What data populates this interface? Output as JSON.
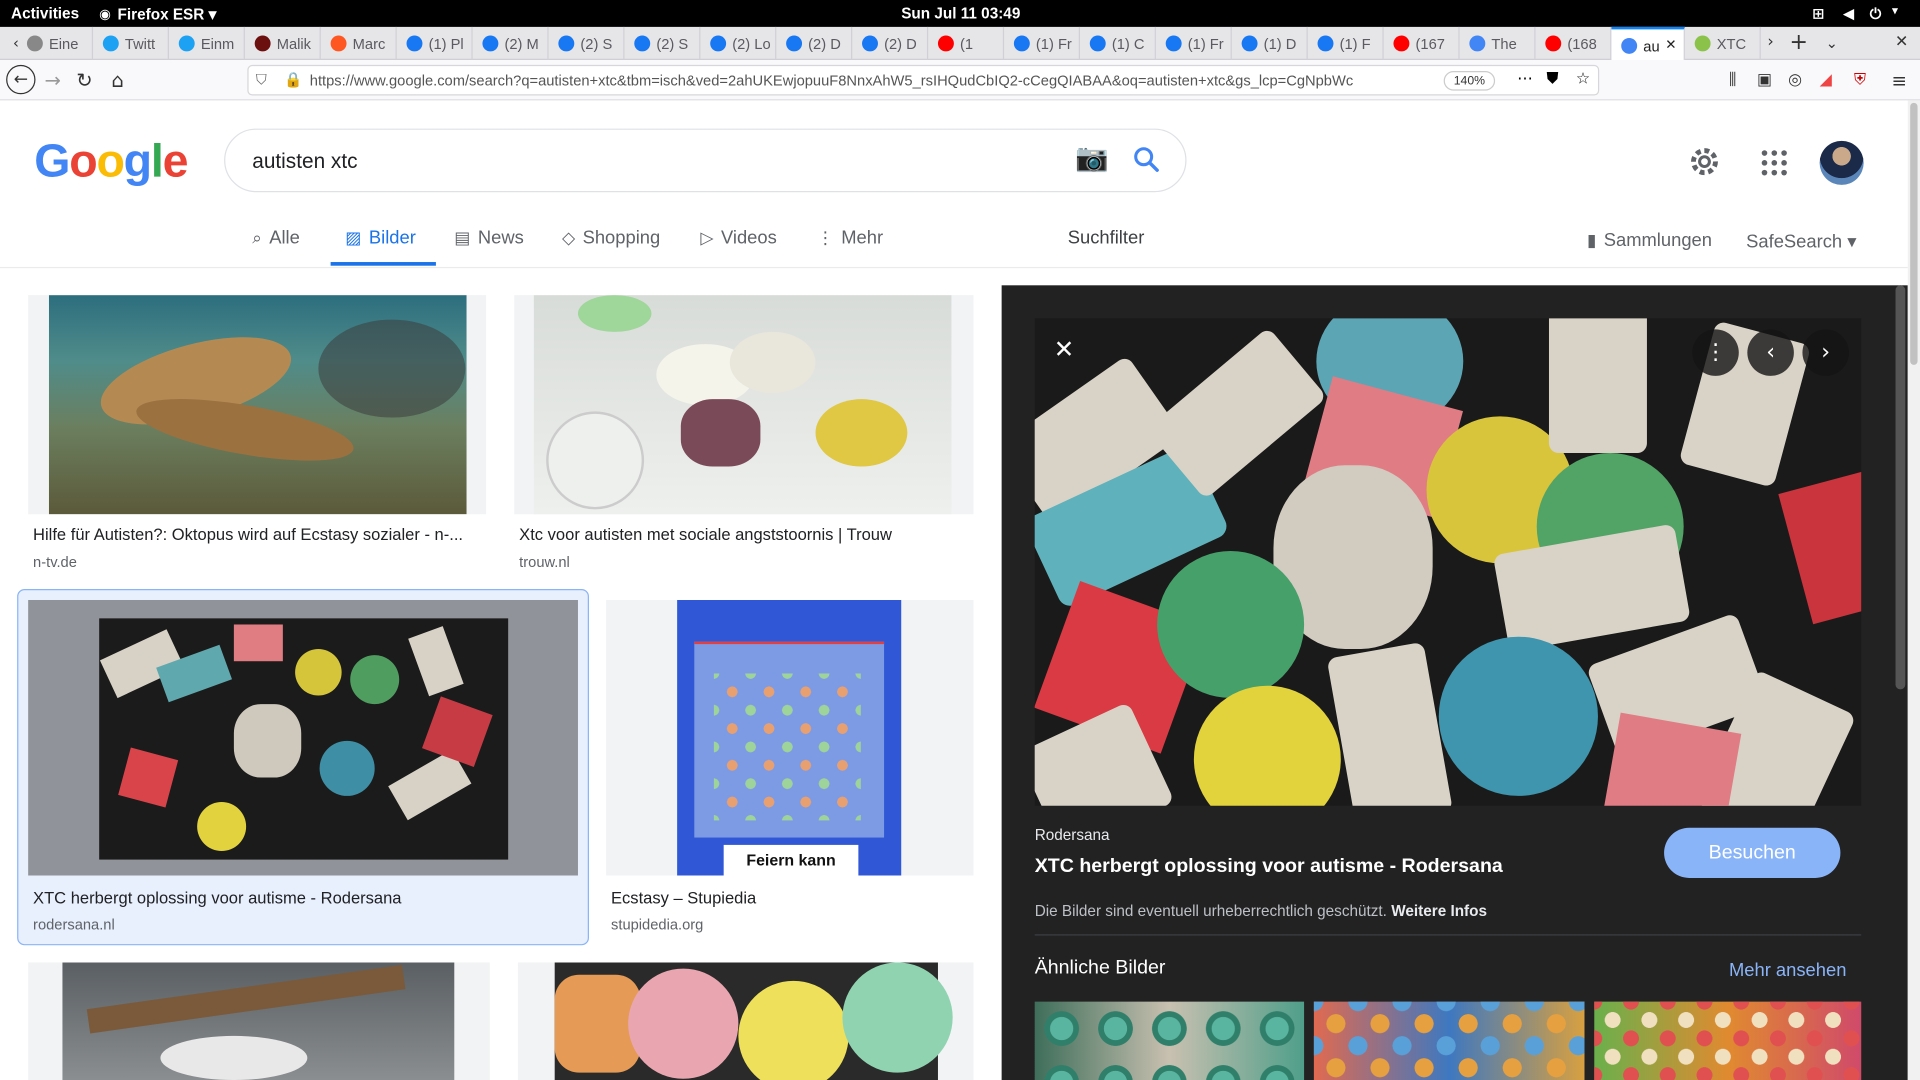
{
  "system_bar": {
    "activities": "Activities",
    "app": "Firefox ESR",
    "clock": "Sun Jul 11  03:49"
  },
  "tabs": [
    {
      "label": "Eine",
      "color": "#888888"
    },
    {
      "label": "Twitt",
      "color": "#1da1f2"
    },
    {
      "label": "Einm",
      "color": "#1da1f2"
    },
    {
      "label": "Malik",
      "color": "#6b0f0f"
    },
    {
      "label": "Marc",
      "color": "#ff5722"
    },
    {
      "label": "(1) Pl",
      "color": "#1877f2"
    },
    {
      "label": "(2) M",
      "color": "#1877f2"
    },
    {
      "label": "(2) S",
      "color": "#1877f2"
    },
    {
      "label": "(2) S",
      "color": "#1877f2"
    },
    {
      "label": "(2) Lo",
      "color": "#1877f2"
    },
    {
      "label": "(2) D",
      "color": "#1877f2"
    },
    {
      "label": "(2) D",
      "color": "#1877f2"
    },
    {
      "label": "(1",
      "color": "#ff0000"
    },
    {
      "label": "(1) Fr",
      "color": "#1877f2"
    },
    {
      "label": "(1) C",
      "color": "#1877f2"
    },
    {
      "label": "(1) Fr",
      "color": "#1877f2"
    },
    {
      "label": "(1) D",
      "color": "#1877f2"
    },
    {
      "label": "(1) F",
      "color": "#1877f2"
    },
    {
      "label": "(167",
      "color": "#ff0000"
    },
    {
      "label": "The",
      "color": "#4285f4"
    },
    {
      "label": "(168",
      "color": "#ff0000"
    },
    {
      "label": "au",
      "color": "#4285f4"
    },
    {
      "label": "XTC",
      "color": "#8bc34a"
    }
  ],
  "browser": {
    "url": "https://www.google.com/search?q=autisten+xtc&tbm=isch&ved=2ahUKEwjopuuF8NnxAhW5_rsIHQudCbIQ2-cCegQIABAA&oq=autisten+xtc&gs_lcp=CgNpbWc",
    "zoom": "140%"
  },
  "google": {
    "logo": "Google",
    "query": "autisten xtc",
    "nav": [
      "Alle",
      "Bilder",
      "News",
      "Shopping",
      "Videos",
      "Mehr"
    ],
    "suchfilter": "Suchfilter",
    "sammlungen": "Sammlungen",
    "safesearch": "SafeSearch"
  },
  "results": [
    {
      "title": "Hilfe für Autisten?: Oktopus wird auf Ecstasy sozialer - n-...",
      "source": "n-tv.de"
    },
    {
      "title": "Xtc voor autisten met sociale angststoornis | Trouw",
      "source": "trouw.nl"
    },
    {
      "title": "XTC herbergt oplossing voor autisme - Rodersana",
      "source": "rodersana.nl"
    },
    {
      "title": "Ecstasy – Stupiedia",
      "source": "stupidedia.org"
    }
  ],
  "bag_label": "Feiern kann",
  "panel": {
    "source": "Rodersana",
    "title": "XTC herbergt oplossing voor autisme - Rodersana",
    "visit": "Besuchen",
    "copyright": "Die Bilder sind eventuell urheberrechtlich geschützt.",
    "more_info": "Weitere Infos",
    "similar": "Ähnliche Bilder",
    "see_more": "Mehr ansehen"
  }
}
